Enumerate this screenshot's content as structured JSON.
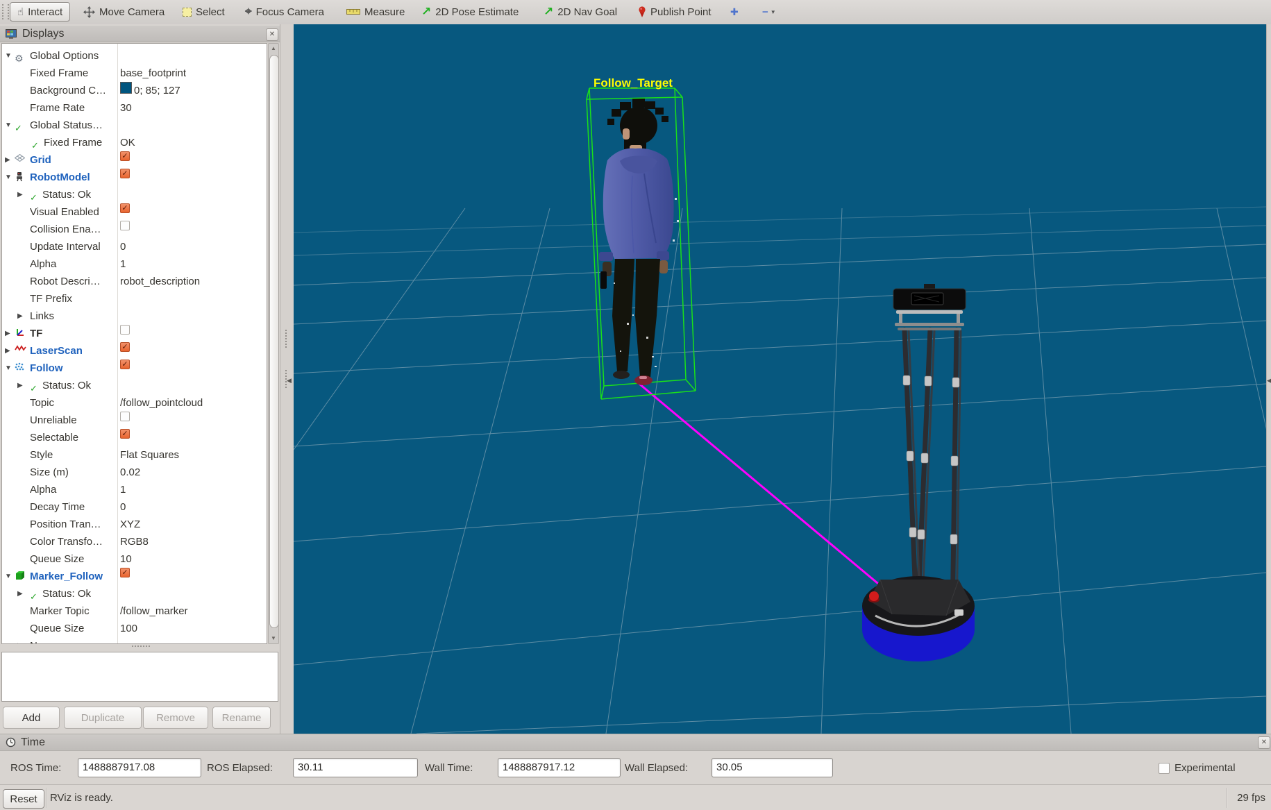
{
  "window": {
    "reset_label": "Reset",
    "status_ready": "RViz is ready.",
    "fps": "29 fps"
  },
  "toolbar": {
    "items": [
      {
        "label": "Interact",
        "icon": "hand-icon",
        "style": "button"
      },
      {
        "label": "Move Camera",
        "icon": "move-icon"
      },
      {
        "label": "Select",
        "icon": "select-box-icon"
      },
      {
        "label": "Focus Camera",
        "icon": "focus-icon"
      },
      {
        "label": "Measure",
        "icon": "measure-ruler-icon"
      },
      {
        "label": "2D Pose Estimate",
        "icon": "pose-arrow-icon"
      },
      {
        "label": "2D Nav Goal",
        "icon": "nav-arrow-icon"
      },
      {
        "label": "Publish Point",
        "icon": "map-pin-icon"
      },
      {
        "label": "",
        "icon": "plus-icon"
      },
      {
        "label": "",
        "icon": "minus-caret-icon"
      }
    ]
  },
  "displays": {
    "title": "Displays",
    "rows": [
      {
        "lvl": 0,
        "arrow": "open",
        "icon": "gear-icon",
        "label": "Global Options"
      },
      {
        "lvl": 1,
        "label": "Fixed Frame",
        "value": {
          "type": "text",
          "text": "base_footprint"
        }
      },
      {
        "lvl": 1,
        "label": "Background C…",
        "value": {
          "type": "color",
          "text": "0; 85; 127",
          "swatch": "#00557f"
        }
      },
      {
        "lvl": 1,
        "label": "Frame Rate",
        "value": {
          "type": "text",
          "text": "30"
        }
      },
      {
        "lvl": 0,
        "arrow": "open",
        "icon": "check-icon",
        "label": "Global Status…"
      },
      {
        "lvl": 1,
        "icon": "check-icon",
        "label": "Fixed Frame",
        "value": {
          "type": "text",
          "text": "OK"
        }
      },
      {
        "lvl": 0,
        "arrow": "closed",
        "icon": "grid-icon",
        "label": "Grid",
        "style": "on",
        "value": {
          "type": "check"
        }
      },
      {
        "lvl": 0,
        "arrow": "open",
        "icon": "robot-icon",
        "label": "RobotModel",
        "style": "on",
        "value": {
          "type": "check"
        }
      },
      {
        "lvl": 1,
        "arrow": "closed",
        "icon": "check-icon",
        "label": "Status: Ok"
      },
      {
        "lvl": 1,
        "label": "Visual Enabled",
        "value": {
          "type": "check"
        }
      },
      {
        "lvl": 1,
        "label": "Collision Ena…",
        "value": {
          "type": "uncheck"
        }
      },
      {
        "lvl": 1,
        "label": "Update Interval",
        "value": {
          "type": "text",
          "text": "0"
        }
      },
      {
        "lvl": 1,
        "label": "Alpha",
        "value": {
          "type": "text",
          "text": "1"
        }
      },
      {
        "lvl": 1,
        "label": "Robot Descri…",
        "value": {
          "type": "text",
          "text": "robot_description"
        }
      },
      {
        "lvl": 1,
        "label": "TF Prefix"
      },
      {
        "lvl": 1,
        "arrow": "closed",
        "label": "Links"
      },
      {
        "lvl": 0,
        "arrow": "closed",
        "icon": "tf-axes-icon",
        "label": "TF",
        "style": "off",
        "value": {
          "type": "uncheck"
        }
      },
      {
        "lvl": 0,
        "arrow": "closed",
        "icon": "laser-scan-icon",
        "label": "LaserScan",
        "style": "on",
        "value": {
          "type": "check"
        }
      },
      {
        "lvl": 0,
        "arrow": "open",
        "icon": "pointcloud-icon",
        "label": "Follow",
        "style": "on",
        "value": {
          "type": "check"
        }
      },
      {
        "lvl": 1,
        "arrow": "closed",
        "icon": "check-icon",
        "label": "Status: Ok"
      },
      {
        "lvl": 1,
        "label": "Topic",
        "value": {
          "type": "text",
          "text": "/follow_pointcloud"
        }
      },
      {
        "lvl": 1,
        "label": "Unreliable",
        "value": {
          "type": "uncheck"
        }
      },
      {
        "lvl": 1,
        "label": "Selectable",
        "value": {
          "type": "check"
        }
      },
      {
        "lvl": 1,
        "label": "Style",
        "value": {
          "type": "text",
          "text": "Flat Squares"
        }
      },
      {
        "lvl": 1,
        "label": "Size (m)",
        "value": {
          "type": "text",
          "text": "0.02"
        }
      },
      {
        "lvl": 1,
        "label": "Alpha",
        "value": {
          "type": "text",
          "text": "1"
        }
      },
      {
        "lvl": 1,
        "label": "Decay Time",
        "value": {
          "type": "text",
          "text": "0"
        }
      },
      {
        "lvl": 1,
        "label": "Position Tran…",
        "value": {
          "type": "text",
          "text": "XYZ"
        }
      },
      {
        "lvl": 1,
        "label": "Color Transfo…",
        "value": {
          "type": "text",
          "text": "RGB8"
        }
      },
      {
        "lvl": 1,
        "label": "Queue Size",
        "value": {
          "type": "text",
          "text": "10"
        }
      },
      {
        "lvl": 0,
        "arrow": "open",
        "icon": "marker-cube-icon",
        "label": "Marker_Follow",
        "style": "on",
        "value": {
          "type": "check"
        }
      },
      {
        "lvl": 1,
        "arrow": "closed",
        "icon": "check-icon",
        "label": "Status: Ok"
      },
      {
        "lvl": 1,
        "label": "Marker Topic",
        "value": {
          "type": "text",
          "text": "/follow_marker"
        }
      },
      {
        "lvl": 1,
        "label": "Queue Size",
        "value": {
          "type": "text",
          "text": "100"
        }
      },
      {
        "lvl": 1,
        "arrow": "closed",
        "label": "N"
      }
    ],
    "buttons": [
      {
        "label": "Add",
        "enabled": true
      },
      {
        "label": "Duplicate",
        "enabled": false
      },
      {
        "label": "Remove",
        "enabled": false
      },
      {
        "label": "Rename",
        "enabled": false
      }
    ]
  },
  "scene": {
    "target_label": "Follow_Target",
    "background_color": "#07587f",
    "grid_color": "#c3ccd2",
    "box_color": "#1ae01a",
    "label_color": "#ffff00",
    "follow_line_color": "#ff00ff"
  },
  "time": {
    "title": "Time",
    "fields": [
      {
        "label": "ROS Time:",
        "value": "1488887917.08"
      },
      {
        "label": "ROS Elapsed:",
        "value": "30.11"
      },
      {
        "label": "Wall Time:",
        "value": "1488887917.12"
      },
      {
        "label": "Wall Elapsed:",
        "value": "30.05"
      }
    ],
    "experimental_label": "Experimental"
  }
}
